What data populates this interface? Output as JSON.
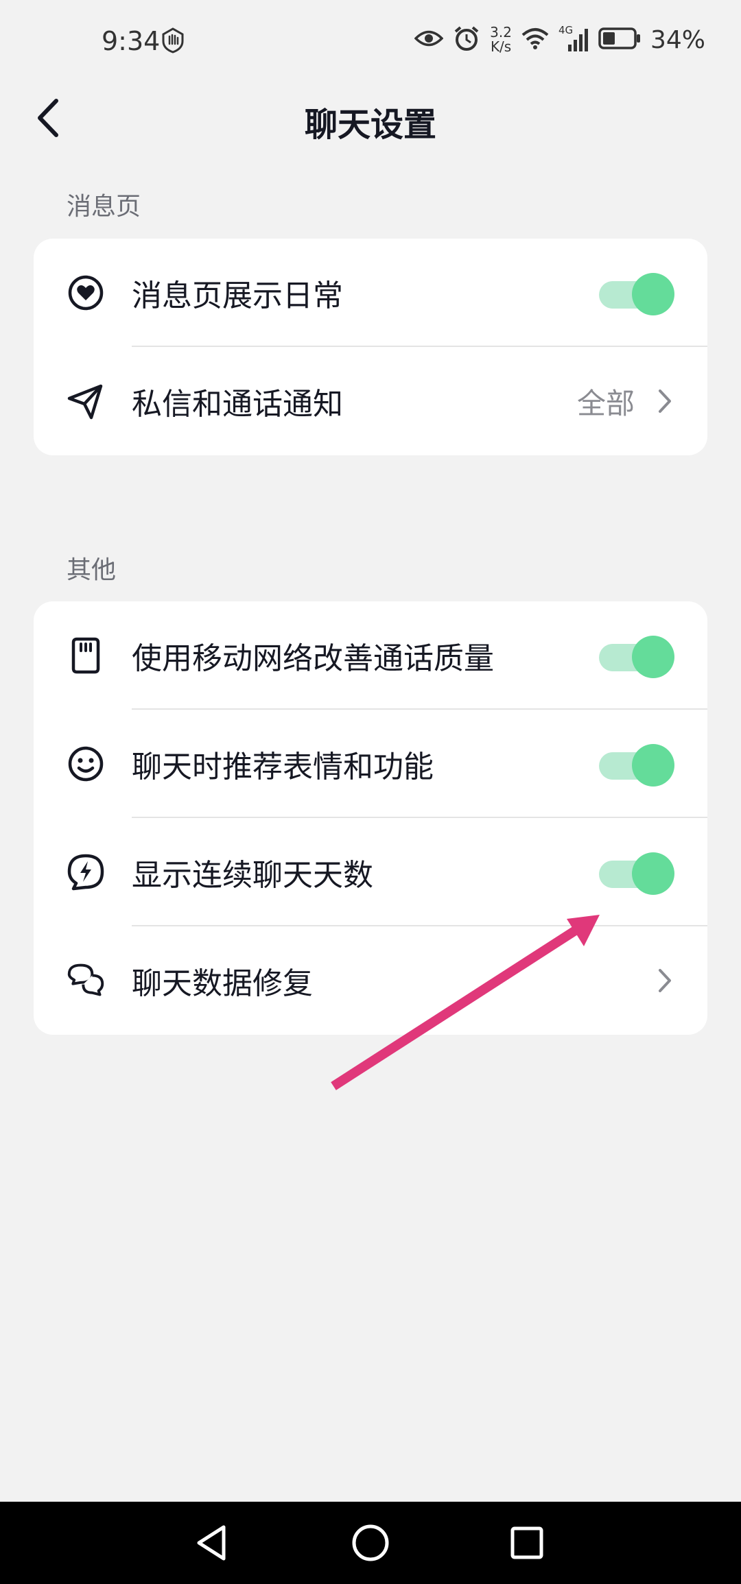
{
  "status_bar": {
    "time": "9:34",
    "net_speed_value": "3.2",
    "net_speed_unit": "K/s",
    "network_type": "4G",
    "battery_level": 0.34,
    "battery_text": "34%",
    "icons": [
      "hand-shield-icon",
      "eye-icon",
      "alarm-icon",
      "wifi-icon",
      "signal-icon",
      "battery-icon"
    ]
  },
  "header": {
    "title": "聊天设置",
    "back_icon": "chevron-left-icon"
  },
  "sections": [
    {
      "label": "消息页",
      "rows": [
        {
          "icon": "heart-circle-icon",
          "label": "消息页展示日常",
          "control": "toggle",
          "on": true
        },
        {
          "icon": "send-icon",
          "label": "私信和通话通知",
          "control": "link",
          "value": "全部"
        }
      ]
    },
    {
      "label": "其他",
      "rows": [
        {
          "icon": "sim-card-icon",
          "label": "使用移动网络改善通话质量",
          "control": "toggle",
          "on": true
        },
        {
          "icon": "smiley-icon",
          "label": "聊天时推荐表情和功能",
          "control": "toggle",
          "on": true
        },
        {
          "icon": "lightning-chat-icon",
          "label": "显示连续聊天天数",
          "control": "toggle",
          "on": true
        },
        {
          "icon": "chat-bubbles-icon",
          "label": "聊天数据修复",
          "control": "link",
          "value": ""
        }
      ]
    }
  ],
  "colors": {
    "background": "#f2f2f2",
    "toggle_on": "#64dc9a",
    "toggle_track": "#b7ead1",
    "annotation_arrow": "#e0387a"
  },
  "nav_bar": {
    "icons": [
      "back-triangle-icon",
      "home-circle-icon",
      "recents-square-icon"
    ]
  }
}
